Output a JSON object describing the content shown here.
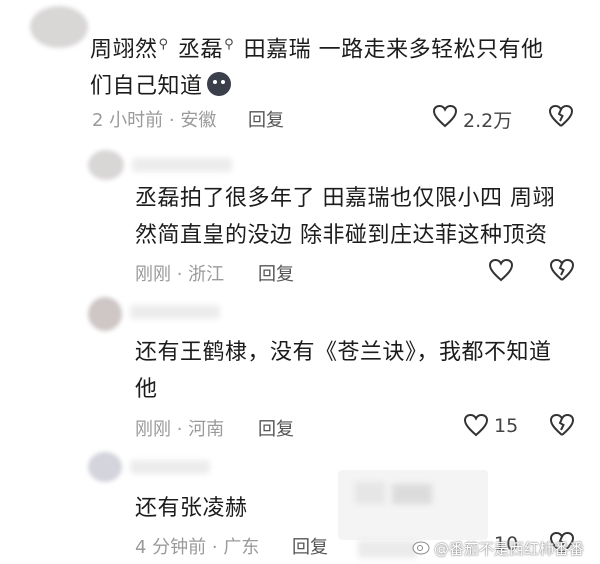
{
  "comments": [
    {
      "mentions": [
        "周翊然",
        "丞磊"
      ],
      "text": "田嘉瑞 一路走来多轻松只有他们自己知道",
      "line1_after": "田嘉瑞 一路走来多轻松只有他",
      "line2": "们自己知道",
      "time": "2 小时前 · 安徽",
      "reply_label": "回复",
      "likes": "2.2万"
    },
    {
      "line1": "丞磊拍了很多年了 田嘉瑞也仅限小四 周翊",
      "line2": "然简直皇的没边 除非碰到庄达菲这种顶资",
      "time": "刚刚 · 浙江",
      "reply_label": "回复",
      "likes": ""
    },
    {
      "line1": "还有王鹤棣，没有《苍兰诀》，我都不知道",
      "line2": "他",
      "time": "刚刚 · 河南",
      "reply_label": "回复",
      "likes": "15"
    },
    {
      "line1": "还有张凌赫",
      "time": "4 分钟前 · 广东",
      "reply_label": "回复",
      "likes": "10"
    }
  ],
  "watermark": "@番茄不是西红柿番番",
  "icons": [
    "heart-icon",
    "broken-heart-icon",
    "search-icon",
    "emoji-icon",
    "weibo-logo-icon"
  ]
}
